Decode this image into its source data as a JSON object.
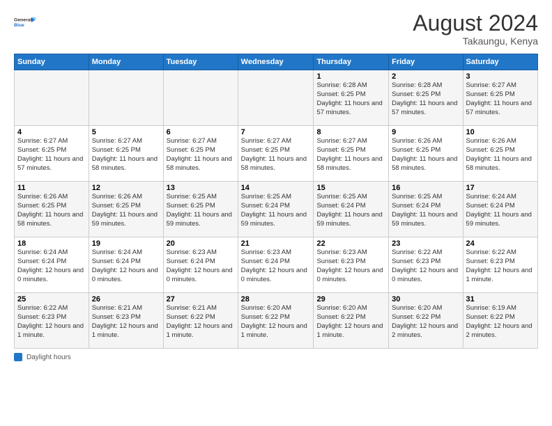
{
  "logo": {
    "line1": "General",
    "line2": "Blue"
  },
  "title": "August 2024",
  "subtitle": "Takaungu, Kenya",
  "days_of_week": [
    "Sunday",
    "Monday",
    "Tuesday",
    "Wednesday",
    "Thursday",
    "Friday",
    "Saturday"
  ],
  "footer_label": "Daylight hours",
  "weeks": [
    [
      {
        "day": "",
        "info": ""
      },
      {
        "day": "",
        "info": ""
      },
      {
        "day": "",
        "info": ""
      },
      {
        "day": "",
        "info": ""
      },
      {
        "day": "1",
        "info": "Sunrise: 6:28 AM\nSunset: 6:25 PM\nDaylight: 11 hours\nand 57 minutes."
      },
      {
        "day": "2",
        "info": "Sunrise: 6:28 AM\nSunset: 6:25 PM\nDaylight: 11 hours\nand 57 minutes."
      },
      {
        "day": "3",
        "info": "Sunrise: 6:27 AM\nSunset: 6:25 PM\nDaylight: 11 hours\nand 57 minutes."
      }
    ],
    [
      {
        "day": "4",
        "info": "Sunrise: 6:27 AM\nSunset: 6:25 PM\nDaylight: 11 hours\nand 57 minutes."
      },
      {
        "day": "5",
        "info": "Sunrise: 6:27 AM\nSunset: 6:25 PM\nDaylight: 11 hours\nand 58 minutes."
      },
      {
        "day": "6",
        "info": "Sunrise: 6:27 AM\nSunset: 6:25 PM\nDaylight: 11 hours\nand 58 minutes."
      },
      {
        "day": "7",
        "info": "Sunrise: 6:27 AM\nSunset: 6:25 PM\nDaylight: 11 hours\nand 58 minutes."
      },
      {
        "day": "8",
        "info": "Sunrise: 6:27 AM\nSunset: 6:25 PM\nDaylight: 11 hours\nand 58 minutes."
      },
      {
        "day": "9",
        "info": "Sunrise: 6:26 AM\nSunset: 6:25 PM\nDaylight: 11 hours\nand 58 minutes."
      },
      {
        "day": "10",
        "info": "Sunrise: 6:26 AM\nSunset: 6:25 PM\nDaylight: 11 hours\nand 58 minutes."
      }
    ],
    [
      {
        "day": "11",
        "info": "Sunrise: 6:26 AM\nSunset: 6:25 PM\nDaylight: 11 hours\nand 58 minutes."
      },
      {
        "day": "12",
        "info": "Sunrise: 6:26 AM\nSunset: 6:25 PM\nDaylight: 11 hours\nand 59 minutes."
      },
      {
        "day": "13",
        "info": "Sunrise: 6:25 AM\nSunset: 6:25 PM\nDaylight: 11 hours\nand 59 minutes."
      },
      {
        "day": "14",
        "info": "Sunrise: 6:25 AM\nSunset: 6:24 PM\nDaylight: 11 hours\nand 59 minutes."
      },
      {
        "day": "15",
        "info": "Sunrise: 6:25 AM\nSunset: 6:24 PM\nDaylight: 11 hours\nand 59 minutes."
      },
      {
        "day": "16",
        "info": "Sunrise: 6:25 AM\nSunset: 6:24 PM\nDaylight: 11 hours\nand 59 minutes."
      },
      {
        "day": "17",
        "info": "Sunrise: 6:24 AM\nSunset: 6:24 PM\nDaylight: 11 hours\nand 59 minutes."
      }
    ],
    [
      {
        "day": "18",
        "info": "Sunrise: 6:24 AM\nSunset: 6:24 PM\nDaylight: 12 hours\nand 0 minutes."
      },
      {
        "day": "19",
        "info": "Sunrise: 6:24 AM\nSunset: 6:24 PM\nDaylight: 12 hours\nand 0 minutes."
      },
      {
        "day": "20",
        "info": "Sunrise: 6:23 AM\nSunset: 6:24 PM\nDaylight: 12 hours\nand 0 minutes."
      },
      {
        "day": "21",
        "info": "Sunrise: 6:23 AM\nSunset: 6:24 PM\nDaylight: 12 hours\nand 0 minutes."
      },
      {
        "day": "22",
        "info": "Sunrise: 6:23 AM\nSunset: 6:23 PM\nDaylight: 12 hours\nand 0 minutes."
      },
      {
        "day": "23",
        "info": "Sunrise: 6:22 AM\nSunset: 6:23 PM\nDaylight: 12 hours\nand 0 minutes."
      },
      {
        "day": "24",
        "info": "Sunrise: 6:22 AM\nSunset: 6:23 PM\nDaylight: 12 hours\nand 1 minute."
      }
    ],
    [
      {
        "day": "25",
        "info": "Sunrise: 6:22 AM\nSunset: 6:23 PM\nDaylight: 12 hours\nand 1 minute."
      },
      {
        "day": "26",
        "info": "Sunrise: 6:21 AM\nSunset: 6:23 PM\nDaylight: 12 hours\nand 1 minute."
      },
      {
        "day": "27",
        "info": "Sunrise: 6:21 AM\nSunset: 6:22 PM\nDaylight: 12 hours\nand 1 minute."
      },
      {
        "day": "28",
        "info": "Sunrise: 6:20 AM\nSunset: 6:22 PM\nDaylight: 12 hours\nand 1 minute."
      },
      {
        "day": "29",
        "info": "Sunrise: 6:20 AM\nSunset: 6:22 PM\nDaylight: 12 hours\nand 1 minute."
      },
      {
        "day": "30",
        "info": "Sunrise: 6:20 AM\nSunset: 6:22 PM\nDaylight: 12 hours\nand 2 minutes."
      },
      {
        "day": "31",
        "info": "Sunrise: 6:19 AM\nSunset: 6:22 PM\nDaylight: 12 hours\nand 2 minutes."
      }
    ]
  ]
}
